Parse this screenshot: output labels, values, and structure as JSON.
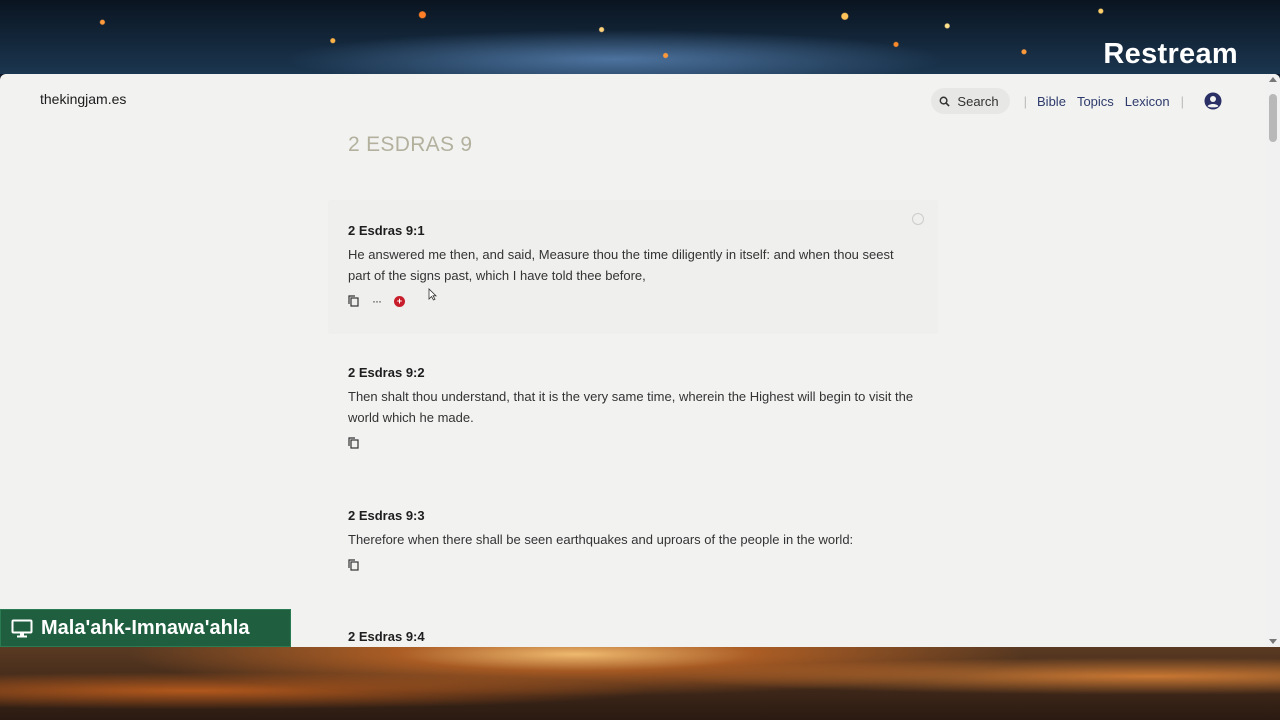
{
  "overlay": {
    "brand": "Restream",
    "source_label": "Mala'ahk-Imnawa'ahla",
    "source_icon": "monitor-icon"
  },
  "header": {
    "site_name": "thekingjam.es",
    "search_label": "Search",
    "nav": [
      "Bible",
      "Topics",
      "Lexicon"
    ],
    "separator": "|",
    "account_icon": "user-circle-icon"
  },
  "main": {
    "chapter_title": "2 ESDRAS 9",
    "verses": [
      {
        "ref": "2 Esdras 9:1",
        "text": "He answered me then, and said, Measure thou the time diligently in itself: and when thou seest part of the signs past, which I have told thee before,",
        "actions": [
          "copy-icon",
          "more-icon",
          "red-badge-icon"
        ],
        "more_label": "···",
        "badge_label": "+"
      },
      {
        "ref": "2 Esdras 9:2",
        "text": "Then shalt thou understand, that it is the very same time, wherein the Highest will begin to visit the world which he made.",
        "actions": [
          "copy-icon"
        ]
      },
      {
        "ref": "2 Esdras 9:3",
        "text": "Therefore when there shall be seen earthquakes and uproars of the people in the world:",
        "actions": [
          "copy-icon"
        ]
      },
      {
        "ref": "2 Esdras 9:4",
        "text": "",
        "actions": []
      }
    ]
  },
  "colors": {
    "page_bg": "#f2f2f1",
    "title": "#b3b19e",
    "nav_link": "#2d3a6b",
    "badge": "#c81e2b",
    "stream_label_bg": "#1f5f3f"
  }
}
